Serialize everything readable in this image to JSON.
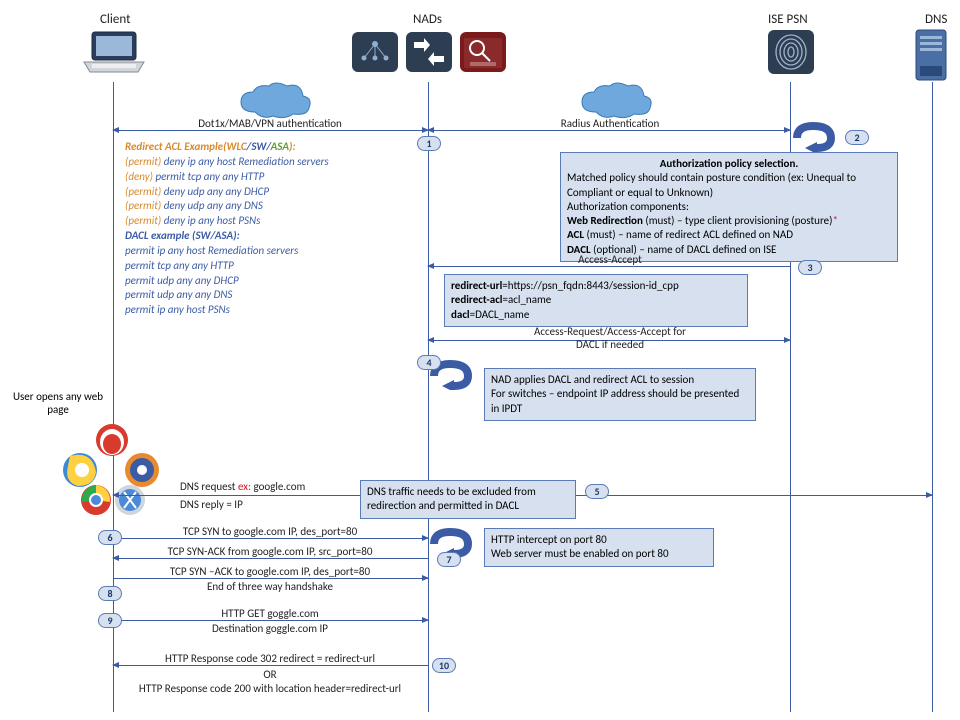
{
  "actors": {
    "client": "Client",
    "nads": "NADs",
    "ise": "ISE PSN",
    "dns": "DNS"
  },
  "clouds": {},
  "acl": {
    "title_prefix": "Redirect ACL Example(",
    "wlc": "WLC",
    "sw": "SW",
    "asa": "ASA",
    "title_suffix": "):",
    "r1_p": "(permit) ",
    "r1_d": "deny ",
    "r1_t": "ip any host Remediation servers",
    "r2_p": "(deny) ",
    "r2_d": "permit ",
    "r2_t": "tcp any any HTTP",
    "r3_p": "(permit) ",
    "r3_d": "deny ",
    "r3_t": "udp any any  DHCP",
    "r4_p": "(permit) ",
    "r4_d": "deny ",
    "r4_t": "udp any any DNS",
    "r5_p": "(permit) ",
    "r5_d": "deny ",
    "r5_t": "ip any host PSNs",
    "dacl_title": "DACL example (SW/ASA):",
    "d1": "permit ip any host Remediation servers",
    "d2": "permit tcp any any HTTP",
    "d3": "permit udp any any  DHCP",
    "d4": "permit udp any any DNS",
    "d5": "permit ip any host PSNs"
  },
  "msgs": {
    "auth1": "Dot1x/MAB/VPN  authentication",
    "auth2": "Radius Authentication",
    "access_accept": "Access-Accept",
    "dacl_req": "Access-Request/Access-Accept for",
    "dacl_req2": "DACL  if needed",
    "dns_req": "DNS request ",
    "dns_req_ex": "ex:",
    "dns_req_host": " google.com",
    "dns_reply": "DNS reply = IP",
    "syn": "TCP SYN to google.com IP, des_port=80",
    "synack": "TCP SYN-ACK  from google.com IP, src_port=80",
    "ack": "TCP SYN –ACK to google.com IP, des_port=80",
    "handshake_end": "End of three way handshake",
    "http_get": "HTTP GET goggle.com",
    "http_dest": "Destination goggle.com IP",
    "resp302": "HTTP Response code 302 redirect = redirect-url",
    "or": "OR",
    "resp200": "HTTP Response code 200 with location header=redirect-url"
  },
  "boxes": {
    "authz": {
      "title": "Authorization  policy selection.",
      "l1": "Matched policy should contain posture condition (ex: Unequal to Compliant or equal to Unknown)",
      "l2": "Authorization components:",
      "l3a": "Web Redirection",
      "l3b": " (must) – type client provisioning (posture)",
      "l4a": "ACL",
      "l4b": " (must) – name of redirect ACL defined on NAD",
      "l5a": "DACL",
      "l5b": " (optional) – name of DACL defined on ISE"
    },
    "redirect": {
      "l1a": "redirect-url",
      "l1b": "=https://psn_fqdn:8443/session-id_cpp",
      "l2a": "redirect-acl",
      "l2b": "=acl_name",
      "l3a": "dacl",
      "l3b": "=DACL_name"
    },
    "nad_applies": {
      "l1": "NAD applies DACL and redirect ACL to session",
      "l2": "For switches – endpoint IP address should be presented  in IPDT"
    },
    "dns_note": {
      "l1": "DNS traffic needs to be excluded from redirection and permitted  in DACL"
    },
    "http_intercept": {
      "l1": "HTTP intercept on port 80",
      "l2": "Web server must be enabled on port 80"
    }
  },
  "side": {
    "user_opens": "User opens any web page"
  },
  "steps": {
    "s1": "1",
    "s2": "2",
    "s3": "3",
    "s4": "4",
    "s5": "5",
    "s6": "6",
    "s7": "7",
    "s8": "8",
    "s9": "9",
    "s10": "10"
  }
}
